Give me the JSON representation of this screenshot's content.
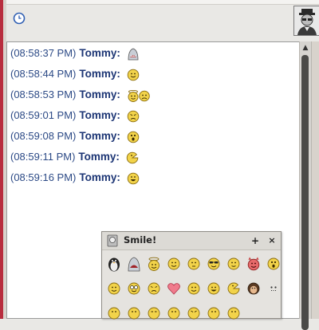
{
  "colors": {
    "timestamp": "#2c4a86",
    "username": "#1d3675",
    "smiley": "#f2d34a"
  },
  "messages": [
    {
      "time": "(08:58:37 PM)",
      "user": "Tommy:",
      "emoticon": "shark-icon"
    },
    {
      "time": "(08:58:44 PM)",
      "user": "Tommy:",
      "emoticon": "smile-icon"
    },
    {
      "time": "(08:58:53 PM)",
      "user": "Tommy:",
      "emoticon": "angel-sad-icon"
    },
    {
      "time": "(08:59:01 PM)",
      "user": "Tommy:",
      "emoticon": "annoyed-icon"
    },
    {
      "time": "(08:59:08 PM)",
      "user": "Tommy:",
      "emoticon": "surprised-icon"
    },
    {
      "time": "(08:59:11 PM)",
      "user": "Tommy:",
      "emoticon": "pacman-smiley-icon"
    },
    {
      "time": "(08:59:16 PM)",
      "user": "Tommy:",
      "emoticon": "grin-icon"
    }
  ],
  "smile_popup": {
    "title": "Smile!",
    "pin_label": "+",
    "close_label": "×",
    "emoticons": [
      "penguin-icon",
      "shark-icon",
      "angel-icon",
      "smile-icon",
      "smile-icon",
      "cool-sunglasses-icon",
      "smile-icon",
      "devil-icon",
      "surprised-icon",
      "smile-icon",
      "nerd-icon",
      "annoyed-icon",
      "heart-icon",
      "smile-icon",
      "smile-icon",
      "pacman-smiley-icon",
      "monkey-icon",
      "dots-face-icon",
      "grin-icon",
      "smile-icon",
      "smile-icon",
      "smile-icon",
      "smile-icon",
      "smile-icon",
      "smile-icon"
    ]
  }
}
